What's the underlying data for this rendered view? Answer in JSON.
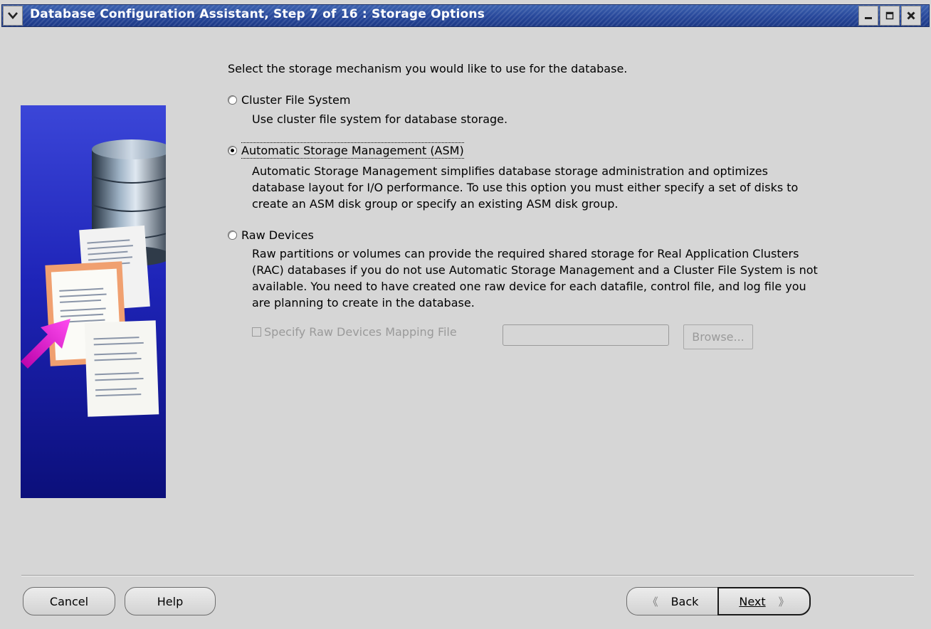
{
  "window": {
    "title": "Database Configuration Assistant, Step 7 of 16 : Storage Options"
  },
  "intro": "Select the storage mechanism you would like to use for the database.",
  "options": [
    {
      "label": "Cluster File System",
      "selected": false,
      "description": [
        "Use cluster file system for database storage."
      ]
    },
    {
      "label": "Automatic Storage Management (ASM)",
      "selected": true,
      "description": [
        "Automatic Storage Management simplifies database storage administration and optimizes",
        "database layout for I/O performance. To use this option you must either specify a set of disks to",
        "create an ASM disk group or specify an existing ASM disk group."
      ]
    },
    {
      "label": "Raw Devices",
      "selected": false,
      "description": [
        "Raw partitions or volumes can provide the required shared storage for Real Application Clusters",
        "(RAC) databases if you do not use Automatic Storage Management and a Cluster File System is not",
        "available.  You need to have created one raw device for each datafile, control file, and log file you",
        "are planning to create in the database."
      ]
    }
  ],
  "raw_mapping": {
    "checkbox_label": "Specify Raw Devices Mapping File",
    "checked": false,
    "input_value": "",
    "browse_label": "Browse..."
  },
  "buttons": {
    "cancel": "Cancel",
    "help": "Help",
    "back": "Back",
    "next": "Next"
  },
  "colors": {
    "background": "#d6d6d6",
    "titlebar": "#27479a",
    "illustration": "#1e24b8",
    "arrow": "#e020c0"
  },
  "icons": {
    "window_menu": "chevron-down-icon",
    "minimize": "minimize-icon",
    "maximize": "maximize-icon",
    "close": "close-icon"
  }
}
